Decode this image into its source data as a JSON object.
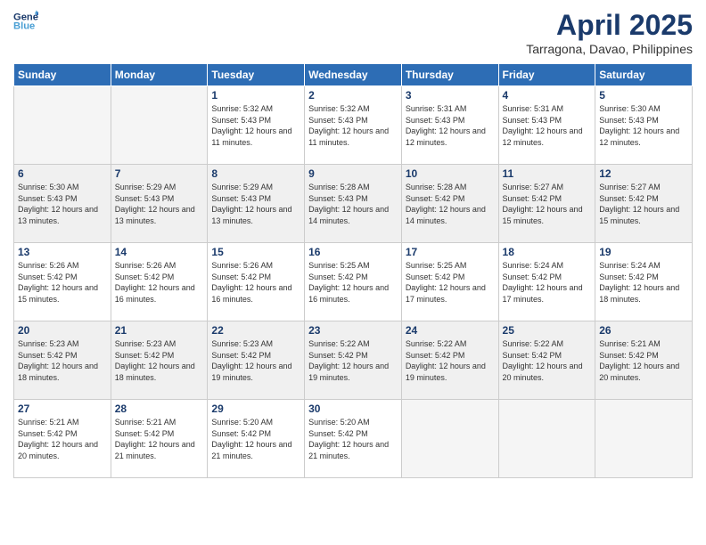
{
  "header": {
    "logo_line1": "General",
    "logo_line2": "Blue",
    "month_title": "April 2025",
    "subtitle": "Tarragona, Davao, Philippines"
  },
  "weekdays": [
    "Sunday",
    "Monday",
    "Tuesday",
    "Wednesday",
    "Thursday",
    "Friday",
    "Saturday"
  ],
  "weeks": [
    [
      {
        "day": "",
        "info": ""
      },
      {
        "day": "",
        "info": ""
      },
      {
        "day": "1",
        "info": "Sunrise: 5:32 AM\nSunset: 5:43 PM\nDaylight: 12 hours and 11 minutes."
      },
      {
        "day": "2",
        "info": "Sunrise: 5:32 AM\nSunset: 5:43 PM\nDaylight: 12 hours and 11 minutes."
      },
      {
        "day": "3",
        "info": "Sunrise: 5:31 AM\nSunset: 5:43 PM\nDaylight: 12 hours and 12 minutes."
      },
      {
        "day": "4",
        "info": "Sunrise: 5:31 AM\nSunset: 5:43 PM\nDaylight: 12 hours and 12 minutes."
      },
      {
        "day": "5",
        "info": "Sunrise: 5:30 AM\nSunset: 5:43 PM\nDaylight: 12 hours and 12 minutes."
      }
    ],
    [
      {
        "day": "6",
        "info": "Sunrise: 5:30 AM\nSunset: 5:43 PM\nDaylight: 12 hours and 13 minutes."
      },
      {
        "day": "7",
        "info": "Sunrise: 5:29 AM\nSunset: 5:43 PM\nDaylight: 12 hours and 13 minutes."
      },
      {
        "day": "8",
        "info": "Sunrise: 5:29 AM\nSunset: 5:43 PM\nDaylight: 12 hours and 13 minutes."
      },
      {
        "day": "9",
        "info": "Sunrise: 5:28 AM\nSunset: 5:43 PM\nDaylight: 12 hours and 14 minutes."
      },
      {
        "day": "10",
        "info": "Sunrise: 5:28 AM\nSunset: 5:42 PM\nDaylight: 12 hours and 14 minutes."
      },
      {
        "day": "11",
        "info": "Sunrise: 5:27 AM\nSunset: 5:42 PM\nDaylight: 12 hours and 15 minutes."
      },
      {
        "day": "12",
        "info": "Sunrise: 5:27 AM\nSunset: 5:42 PM\nDaylight: 12 hours and 15 minutes."
      }
    ],
    [
      {
        "day": "13",
        "info": "Sunrise: 5:26 AM\nSunset: 5:42 PM\nDaylight: 12 hours and 15 minutes."
      },
      {
        "day": "14",
        "info": "Sunrise: 5:26 AM\nSunset: 5:42 PM\nDaylight: 12 hours and 16 minutes."
      },
      {
        "day": "15",
        "info": "Sunrise: 5:26 AM\nSunset: 5:42 PM\nDaylight: 12 hours and 16 minutes."
      },
      {
        "day": "16",
        "info": "Sunrise: 5:25 AM\nSunset: 5:42 PM\nDaylight: 12 hours and 16 minutes."
      },
      {
        "day": "17",
        "info": "Sunrise: 5:25 AM\nSunset: 5:42 PM\nDaylight: 12 hours and 17 minutes."
      },
      {
        "day": "18",
        "info": "Sunrise: 5:24 AM\nSunset: 5:42 PM\nDaylight: 12 hours and 17 minutes."
      },
      {
        "day": "19",
        "info": "Sunrise: 5:24 AM\nSunset: 5:42 PM\nDaylight: 12 hours and 18 minutes."
      }
    ],
    [
      {
        "day": "20",
        "info": "Sunrise: 5:23 AM\nSunset: 5:42 PM\nDaylight: 12 hours and 18 minutes."
      },
      {
        "day": "21",
        "info": "Sunrise: 5:23 AM\nSunset: 5:42 PM\nDaylight: 12 hours and 18 minutes."
      },
      {
        "day": "22",
        "info": "Sunrise: 5:23 AM\nSunset: 5:42 PM\nDaylight: 12 hours and 19 minutes."
      },
      {
        "day": "23",
        "info": "Sunrise: 5:22 AM\nSunset: 5:42 PM\nDaylight: 12 hours and 19 minutes."
      },
      {
        "day": "24",
        "info": "Sunrise: 5:22 AM\nSunset: 5:42 PM\nDaylight: 12 hours and 19 minutes."
      },
      {
        "day": "25",
        "info": "Sunrise: 5:22 AM\nSunset: 5:42 PM\nDaylight: 12 hours and 20 minutes."
      },
      {
        "day": "26",
        "info": "Sunrise: 5:21 AM\nSunset: 5:42 PM\nDaylight: 12 hours and 20 minutes."
      }
    ],
    [
      {
        "day": "27",
        "info": "Sunrise: 5:21 AM\nSunset: 5:42 PM\nDaylight: 12 hours and 20 minutes."
      },
      {
        "day": "28",
        "info": "Sunrise: 5:21 AM\nSunset: 5:42 PM\nDaylight: 12 hours and 21 minutes."
      },
      {
        "day": "29",
        "info": "Sunrise: 5:20 AM\nSunset: 5:42 PM\nDaylight: 12 hours and 21 minutes."
      },
      {
        "day": "30",
        "info": "Sunrise: 5:20 AM\nSunset: 5:42 PM\nDaylight: 12 hours and 21 minutes."
      },
      {
        "day": "",
        "info": ""
      },
      {
        "day": "",
        "info": ""
      },
      {
        "day": "",
        "info": ""
      }
    ]
  ]
}
